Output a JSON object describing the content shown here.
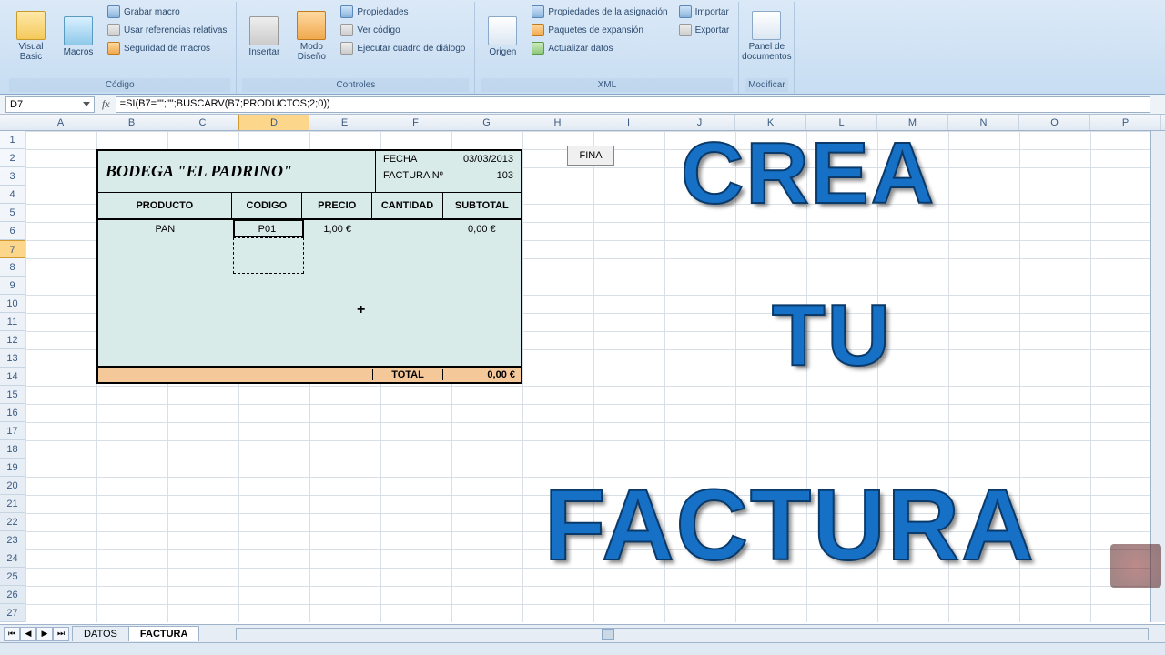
{
  "ribbon": {
    "groups": {
      "codigo": {
        "label": "Código",
        "visual_basic": "Visual\nBasic",
        "macros": "Macros",
        "grabar": "Grabar macro",
        "referencias": "Usar referencias relativas",
        "seguridad": "Seguridad de macros"
      },
      "controles": {
        "label": "Controles",
        "insertar": "Insertar",
        "modo": "Modo\nDiseño",
        "propiedades": "Propiedades",
        "ver_codigo": "Ver código",
        "ejecutar": "Ejecutar cuadro de diálogo"
      },
      "xml": {
        "label": "XML",
        "origen": "Origen",
        "prop_asig": "Propiedades de la asignación",
        "paquetes": "Paquetes de expansión",
        "actualizar": "Actualizar datos",
        "importar": "Importar",
        "exportar": "Exportar"
      },
      "modificar": {
        "label": "Modificar",
        "panel": "Panel de\ndocumentos"
      }
    }
  },
  "namebox": "D7",
  "formula": "=SI(B7=\"\";\"\";BUSCARV(B7;PRODUCTOS;2;0))",
  "columns": [
    "A",
    "B",
    "C",
    "D",
    "E",
    "F",
    "G",
    "H",
    "I",
    "J",
    "K",
    "L",
    "M",
    "N",
    "O",
    "P"
  ],
  "selected_col": "D",
  "selected_row": 7,
  "invoice": {
    "title": "BODEGA \"EL PADRINO\"",
    "fecha_label": "FECHA",
    "fecha_value": "03/03/2013",
    "num_label": "FACTURA Nº",
    "num_value": "103",
    "headers": {
      "producto": "PRODUCTO",
      "codigo": "CODIGO",
      "precio": "PRECIO",
      "cantidad": "CANTIDAD",
      "subtotal": "SUBTOTAL"
    },
    "row1": {
      "producto": "PAN",
      "codigo": "P01",
      "precio": "1,00 €",
      "cantidad": "",
      "subtotal": "0,00 €"
    },
    "total_label": "TOTAL",
    "total_value": "0,00 €"
  },
  "button_fina": "FINA",
  "overlay": {
    "l1": "CREA",
    "l2": "TU",
    "l3": "FACTURA"
  },
  "tabs": {
    "datos": "DATOS",
    "factura": "FACTURA"
  }
}
